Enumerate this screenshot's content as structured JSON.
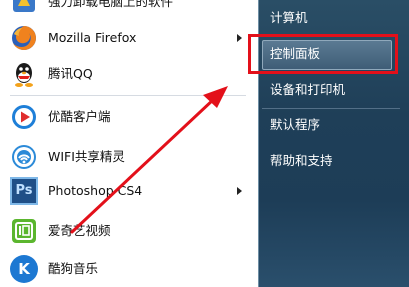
{
  "start_menu": {
    "programs": [
      {
        "label": "强力卸载电脑上的软件",
        "icon": "uninstaller-icon",
        "submenu": false
      },
      {
        "label": "Mozilla Firefox",
        "icon": "firefox-icon",
        "submenu": true
      },
      {
        "label": "腾讯QQ",
        "icon": "qq-icon",
        "submenu": false
      },
      {
        "label": "优酷客户端",
        "icon": "youku-icon",
        "submenu": false
      },
      {
        "label": "WIFI共享精灵",
        "icon": "wifi-sharing-icon",
        "submenu": false
      },
      {
        "label": "Photoshop CS4",
        "icon": "photoshop-icon",
        "submenu": true,
        "icon_text": "Ps"
      },
      {
        "label": "爱奇艺视频",
        "icon": "iqiyi-icon",
        "submenu": false
      },
      {
        "label": "酷狗音乐",
        "icon": "kugou-icon",
        "submenu": false,
        "icon_text": "K"
      }
    ],
    "right_items": [
      {
        "label": "计算机"
      },
      {
        "label": "控制面板",
        "selected": true
      },
      {
        "label": "设备和打印机"
      },
      {
        "label": "默认程序"
      },
      {
        "label": "帮助和支持"
      }
    ],
    "colors": {
      "highlight_border": "#e3101a",
      "annotation_arrow": "#e3101a",
      "right_pane_bg": "#1f3f58"
    }
  }
}
